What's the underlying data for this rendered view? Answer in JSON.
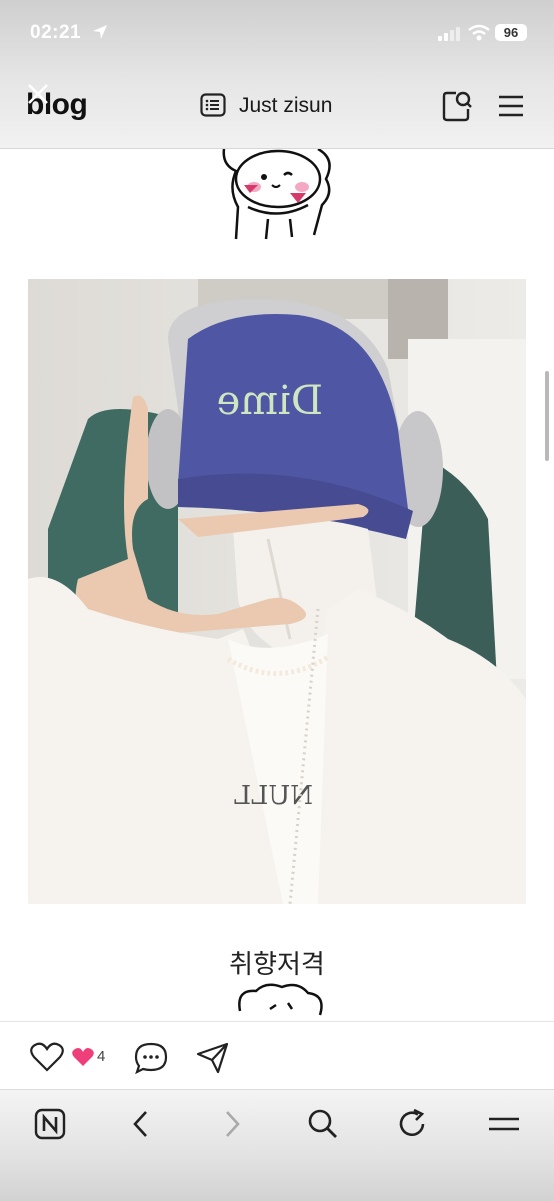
{
  "status_bar": {
    "time": "02:21",
    "battery": "96"
  },
  "header": {
    "logo": "blog",
    "title": "Just zisun"
  },
  "post": {
    "photo_cap_text": "Dime",
    "photo_shirt_text": "NULL",
    "caption": "취향저격"
  },
  "actions": {
    "like_count": "4"
  },
  "colors": {
    "accent_pink": "#ef3f7a",
    "cap": "#4f56a4",
    "cap_text": "#cfe6c0"
  },
  "icons": [
    "close-icon",
    "post-list-icon",
    "search-doc-icon",
    "menu-icon",
    "like-icon",
    "comment-icon",
    "share-icon",
    "naver-home-icon",
    "back-icon",
    "forward-icon",
    "search-icon",
    "refresh-icon",
    "more-menu-icon"
  ]
}
